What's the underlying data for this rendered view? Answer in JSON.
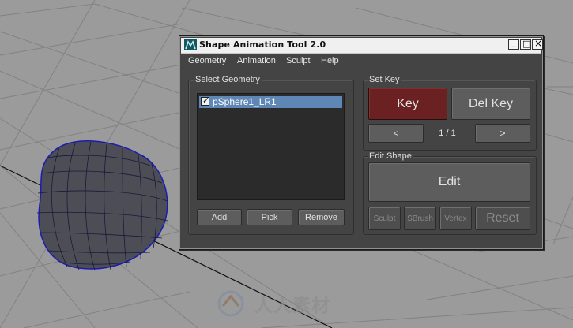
{
  "window": {
    "title": "Shape Animation Tool 2.0",
    "minimize_glyph": "_",
    "maximize_glyph": "□",
    "close_glyph": "×"
  },
  "menu": [
    "Geometry",
    "Animation",
    "Sculpt",
    "Help"
  ],
  "select_geometry": {
    "label": "Select Geometry",
    "items": [
      {
        "name": "pSphere1_LR1",
        "checked": true,
        "check_glyph": "✓"
      }
    ],
    "add_label": "Add",
    "pick_label": "Pick",
    "remove_label": "Remove"
  },
  "set_key": {
    "label": "Set Key",
    "key_label": "Key",
    "del_key_label": "Del Key",
    "prev_label": "<",
    "next_label": ">",
    "counter": "1 / 1"
  },
  "edit_shape": {
    "label": "Edit Shape",
    "edit_label": "Edit",
    "sculpt_label": "Sculpt",
    "sbrush_label": "SBrush",
    "vertex_label": "Vertex",
    "reset_label": "Reset"
  },
  "watermark": "人人素材",
  "colors": {
    "viewport_bg": "#9b9b9b",
    "panel_bg": "#444444",
    "key_button": "#6b2121",
    "selection": "#5f87b6",
    "mesh_wire": "#1b1bb4"
  },
  "icons": {
    "app": "maya-app-icon",
    "watermark_logo": "watermark-logo-icon"
  }
}
